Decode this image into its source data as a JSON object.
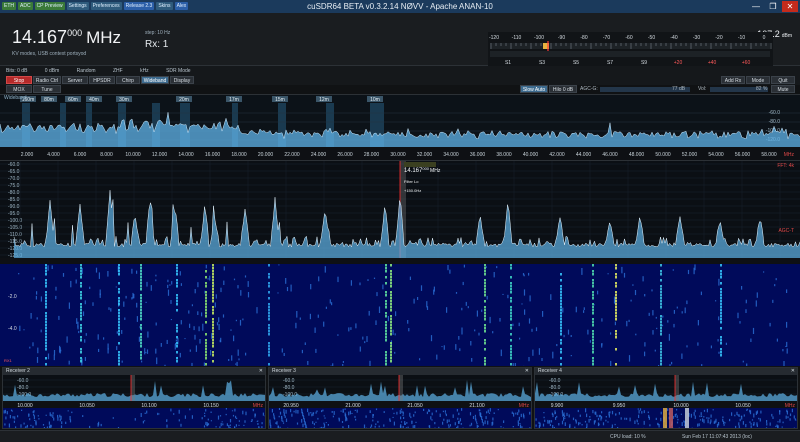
{
  "titlebar": {
    "title": "cuSDR64 BETA   v0.3.2.14          NØVV - Apache ANAN-10",
    "buttons": [
      "ETH",
      "ADC",
      "CP Preview",
      "Settings",
      "Preferences",
      "Release 2.3",
      "Skins",
      "Alex"
    ],
    "minimize": "—",
    "maximize": "❐",
    "close": "✕"
  },
  "header": {
    "freq_main": "14.167",
    "freq_sub": "000",
    "freq_unit": "MHz",
    "step": "step: 10 Hz",
    "rx": "Rx: 1",
    "modes": "KV modes, USB context portsyod",
    "power": "-107.2",
    "power_unit": "dBm",
    "smeter_top": [
      "-120",
      "-110",
      "-100",
      "-90",
      "-80",
      "-70",
      "-60",
      "-50",
      "-40",
      "-30",
      "-20",
      "-10",
      "0"
    ],
    "smeter_bottom": [
      "S1",
      "S3",
      "S5",
      "S7",
      "S9",
      "+20",
      "+40",
      "+60"
    ]
  },
  "inforow": [
    "Bits: 0 dB",
    "0 dBm",
    "Random",
    "ZHF",
    "kHz",
    "SDR Mode"
  ],
  "buttons_row1": [
    {
      "label": "Stop",
      "style": "red"
    },
    {
      "label": "Radio Ctrl",
      "style": ""
    },
    {
      "label": "Server",
      "style": ""
    },
    {
      "label": "HPSDR",
      "style": ""
    },
    {
      "label": "Chirp",
      "style": ""
    },
    {
      "label": "Wideband",
      "style": "sel"
    },
    {
      "label": "Display",
      "style": ""
    }
  ],
  "buttons_row1_right": [
    "Add Rx",
    "Mode",
    "Quit"
  ],
  "buttons_row2": [
    "MOX",
    "Tune"
  ],
  "controls": {
    "agc_label": "AGC-G:",
    "vol_label": "Vol:",
    "agc_value": "77 dB",
    "vol_value": "82 %",
    "agc_btn1": "Slow Auto",
    "agc_btn2": "Hilo 0 dB",
    "mute": "Mute"
  },
  "wideband": {
    "label": "Wideband",
    "band_labels": [
      "160m",
      "80m",
      "60m",
      "40m",
      "30m",
      "20m",
      "17m",
      "15m",
      "12m",
      "10m"
    ],
    "db_labels": [
      "-60.0",
      "-80.0",
      "-100.0",
      "-120.0"
    ],
    "freq_labels": [
      "2.000",
      "4.000",
      "6.000",
      "8.000",
      "10.000",
      "12.000",
      "14.000",
      "16.000",
      "18.000",
      "20.000",
      "22.000",
      "24.000",
      "26.000",
      "28.000",
      "30.000",
      "32.000",
      "34.000",
      "36.000",
      "38.000",
      "40.000",
      "42.000",
      "44.000",
      "46.000",
      "48.000",
      "50.000",
      "52.000",
      "54.000",
      "56.000",
      "58.000"
    ],
    "unit": "MHz"
  },
  "panadapter": {
    "db_labels": [
      "-60.0",
      "-65.0",
      "-70.0",
      "-75.0",
      "-80.0",
      "-85.0",
      "-90.0",
      "-95.0",
      "-100.0",
      "-105.0",
      "-110.0",
      "-115.0",
      "-120.0",
      "-125.0"
    ],
    "marker_freq": "14.167",
    "marker_sub": "000",
    "marker_unit": "MHz",
    "marker_info1": "Filter Lo",
    "marker_info2": "+150.0Hz",
    "fft": "FFT: 4k",
    "agc_t": "AGC-T",
    "freq_labels": [
      "13.998",
      "14.000",
      "14.020",
      "14.040",
      "14.060",
      "14.080",
      "14.100",
      "14.120",
      "14.140",
      "14.160",
      "14.180",
      "14.200",
      "14.220",
      "14.240",
      "14.260",
      "14.280",
      "14.300",
      "14.320",
      "14.340"
    ],
    "unit": "MHz"
  },
  "waterfall": {
    "time_labels": [
      "-2.0",
      "-4.0"
    ],
    "corner": "RX1"
  },
  "subrx": [
    {
      "title": "Receiver 2",
      "freqs": [
        "10.000",
        "10.050",
        "10.100",
        "10.150"
      ],
      "unit": "MHz",
      "db": [
        "-60.0",
        "-80.0",
        "-100.0"
      ]
    },
    {
      "title": "Receiver 3",
      "freqs": [
        "20.950",
        "21.000",
        "21.050",
        "21.100"
      ],
      "unit": "MHz",
      "db": [
        "-60.0",
        "-80.0",
        "-100.0"
      ]
    },
    {
      "title": "Receiver 4",
      "freqs": [
        "9.900",
        "9.950",
        "10.000",
        "10.050"
      ],
      "unit": "MHz",
      "db": [
        "-60.0",
        "-80.0",
        "-100.0"
      ]
    }
  ],
  "status": {
    "cpu": "CPU load: 10 %",
    "time": "Sun Feb 17 11:07:43 2013 (loc)"
  },
  "colors": {
    "spectrum_fill": "#5fb3e8",
    "spectrum_line": "#e8f6ff",
    "waterfall_bg": "#000a5a",
    "accent_red": "#b52a2a",
    "marker_red": "#ff2b2b"
  }
}
